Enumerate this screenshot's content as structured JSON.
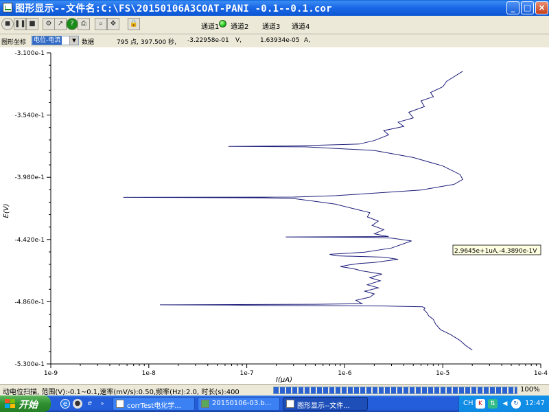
{
  "window": {
    "title": "图形显示--文件名:C:\\FS\\20150106A3COAT-PANI -0.1--0.1.cor",
    "min": "_",
    "max": "□",
    "close": "×"
  },
  "toolbar": {
    "channels": [
      "通道1",
      "通道2",
      "通道3",
      "通道4"
    ]
  },
  "infobar": {
    "coord_label": "图形坐标",
    "coord_select": "电位-电流",
    "data_label": "数据",
    "points": "795 点,",
    "time": "397.500 秒,",
    "potential": "-3.22958e-01",
    "potential_unit": "V,",
    "current": "1.63934e-05",
    "current_unit": "A,"
  },
  "chart_data": {
    "type": "line",
    "xlabel": "I(μA)",
    "ylabel": "E(V)",
    "x_scale": "log",
    "xlim": [
      1e-09,
      0.0001
    ],
    "ylim": [
      -0.53,
      -0.31
    ],
    "x_ticks": [
      "1e-9",
      "1e-8",
      "1e-7",
      "1e-6",
      "1e-5",
      "1e-4"
    ],
    "y_ticks": [
      "-3.100e-1",
      "-3.540e-1",
      "-3.980e-1",
      "-4.420e-1",
      "-4.860e-1",
      "-5.300e-1"
    ],
    "grid": false,
    "annotation": "2.9645e+1uA,-4.3890e-1V",
    "series": [
      {
        "color": "#1c1c7a",
        "points": [
          [
            2e-05,
            -0.5202
          ],
          [
            1.7e-05,
            -0.5168
          ],
          [
            1.5e-05,
            -0.5134
          ],
          [
            1.2e-05,
            -0.5092
          ],
          [
            9.5e-06,
            -0.5058
          ],
          [
            8.5e-06,
            -0.502
          ],
          [
            8e-06,
            -0.4985
          ],
          [
            7.2e-06,
            -0.496
          ],
          [
            6.8e-06,
            -0.4933
          ],
          [
            6.4e-06,
            -0.4917
          ],
          [
            6.6e-06,
            -0.4905
          ],
          [
            6.2e-06,
            -0.4896
          ],
          [
            2.5e-06,
            -0.489
          ],
          [
            1.3e-07,
            -0.4886
          ],
          [
            6.5e-08,
            -0.4884
          ],
          [
            1.3e-08,
            -0.4882
          ],
          [
            8e-08,
            -0.488
          ],
          [
            5e-07,
            -0.4878
          ],
          [
            1.5e-06,
            -0.4874
          ],
          [
            1.3e-06,
            -0.485
          ],
          [
            1.8e-06,
            -0.4828
          ],
          [
            2e-06,
            -0.4805
          ],
          [
            1.6e-06,
            -0.4785
          ],
          [
            2.2e-06,
            -0.4762
          ],
          [
            1.7e-06,
            -0.474
          ],
          [
            2.3e-06,
            -0.4712
          ],
          [
            1.8e-06,
            -0.469
          ],
          [
            2.4e-06,
            -0.4665
          ],
          [
            1.5e-06,
            -0.4642
          ],
          [
            1.2e-06,
            -0.4625
          ],
          [
            9e-07,
            -0.4612
          ],
          [
            1.1e-06,
            -0.46
          ],
          [
            1.4e-06,
            -0.459
          ],
          [
            2e-06,
            -0.4582
          ],
          [
            3.5e-06,
            -0.456
          ],
          [
            2.5e-06,
            -0.4545
          ],
          [
            8e-07,
            -0.4535
          ],
          [
            7e-07,
            -0.4525
          ],
          [
            1.6e-06,
            -0.451
          ],
          [
            3e-06,
            -0.448
          ],
          [
            4.8e-06,
            -0.443
          ],
          [
            3e-06,
            -0.441
          ],
          [
            1.8e-06,
            -0.4405
          ],
          [
            2.5e-07,
            -0.4402
          ],
          [
            2.8e-06,
            -0.4399
          ],
          [
            2e-06,
            -0.438
          ],
          [
            2.5e-06,
            -0.435
          ],
          [
            1.9e-06,
            -0.432
          ],
          [
            2.2e-06,
            -0.429
          ],
          [
            1.7e-06,
            -0.426
          ],
          [
            1.8e-06,
            -0.423
          ],
          [
            1.2e-06,
            -0.42
          ],
          [
            8e-07,
            -0.417
          ],
          [
            5e-07,
            -0.415
          ],
          [
            3e-07,
            -0.413
          ],
          [
            1.5e-07,
            -0.4125
          ],
          [
            5.5e-09,
            -0.4122
          ],
          [
            3e-07,
            -0.412
          ],
          [
            8e-07,
            -0.411
          ],
          [
            6e-06,
            -0.407
          ],
          [
            1.3e-05,
            -0.403
          ],
          [
            1.6e-05,
            -0.3995
          ],
          [
            1.5e-05,
            -0.396
          ],
          [
            1e-05,
            -0.39
          ],
          [
            5e-06,
            -0.384
          ],
          [
            2e-06,
            -0.379
          ],
          [
            4e-07,
            -0.3765
          ],
          [
            6.5e-08,
            -0.3762
          ],
          [
            3e-07,
            -0.3758
          ],
          [
            1.4e-06,
            -0.3745
          ],
          [
            2e-06,
            -0.372
          ],
          [
            2.8e-06,
            -0.368
          ],
          [
            2.5e-06,
            -0.365
          ],
          [
            4e-06,
            -0.362
          ],
          [
            3.5e-06,
            -0.359
          ],
          [
            5e-06,
            -0.356
          ],
          [
            4.5e-06,
            -0.352
          ],
          [
            6.5e-06,
            -0.348
          ],
          [
            6e-06,
            -0.344
          ],
          [
            8e-06,
            -0.341
          ],
          [
            7.5e-06,
            -0.338
          ],
          [
            1e-05,
            -0.334
          ],
          [
            1.1e-05,
            -0.33
          ],
          [
            1.6e-05,
            -0.323
          ]
        ]
      }
    ]
  },
  "status": {
    "text": "动电位扫描, 范围(V):-0.1~0.1,速率(mV/s):0.50,频率(Hz):2.0, 时长(s):400",
    "progress": 1.0,
    "progress_label": "100%"
  },
  "taskbar": {
    "start": "开始",
    "tasks": [
      "corrTest电化学...",
      "20150106-03.b...",
      "图形显示--文件..."
    ],
    "lang": "CH",
    "clock": "12:47"
  }
}
